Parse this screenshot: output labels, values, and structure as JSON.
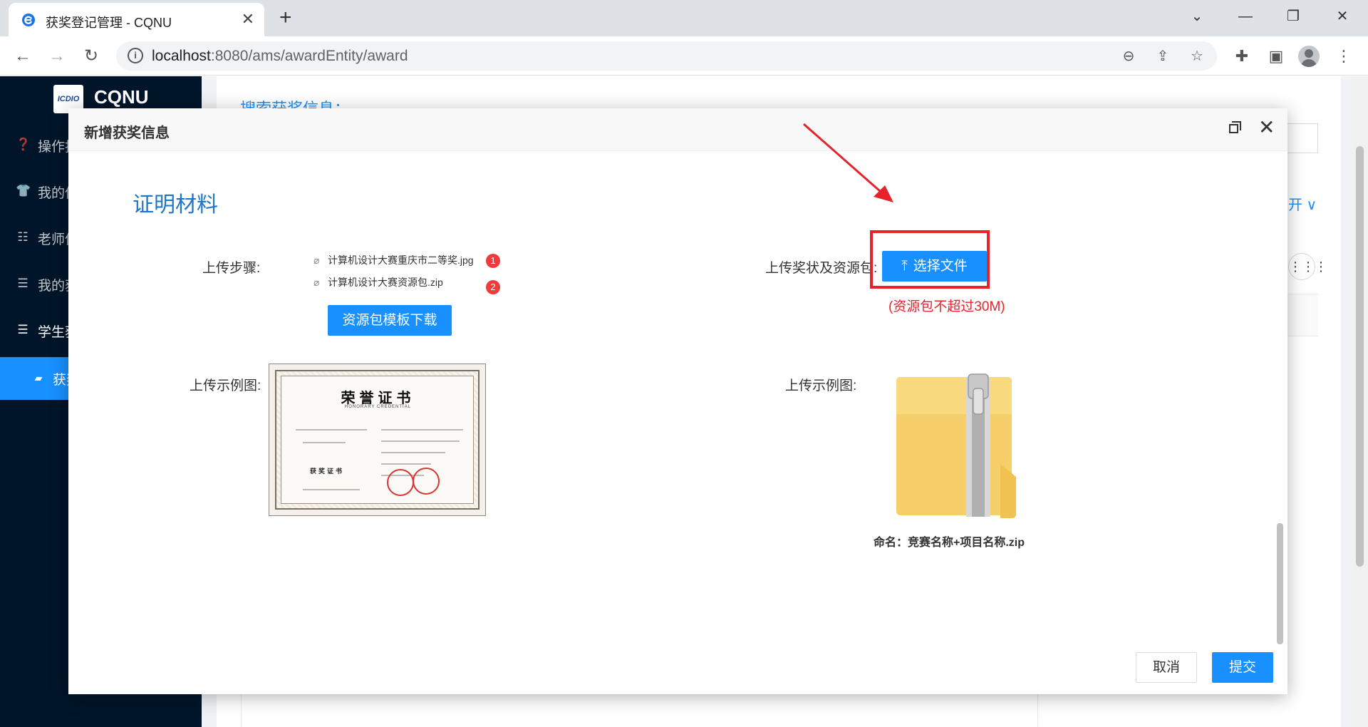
{
  "browser": {
    "tab_title": "获奖登记管理 - CQNU",
    "url_host": "localhost",
    "url_path": ":8080/ams/awardEntity/award"
  },
  "sidebar": {
    "logo_badge": "ICDIO",
    "logo_text": "CQNU",
    "items": [
      {
        "label": "操作指南",
        "icon": "question-circle-icon"
      },
      {
        "label": "我的信息",
        "icon": "shirt-icon"
      },
      {
        "label": "老师信息",
        "icon": "list-icon"
      },
      {
        "label": "我的获奖",
        "icon": "menu-icon"
      },
      {
        "label": "学生获奖",
        "icon": "menu-icon"
      },
      {
        "label": "获奖登记",
        "icon": "folder-icon"
      }
    ]
  },
  "background": {
    "search_title": "搜索获奖信息：",
    "expand_label": "开"
  },
  "modal": {
    "title": "新增获奖信息",
    "section_title": "证明材料",
    "upload_steps_label": "上传步骤:",
    "steps": [
      {
        "file": "计算机设计大赛重庆市二等奖.jpg",
        "badge": "1"
      },
      {
        "file": "计算机设计大赛资源包.zip",
        "badge": "2"
      }
    ],
    "template_button": "资源包模板下载",
    "upload_award_label": "上传奖状及资源包:",
    "choose_file_button": "选择文件",
    "size_note": "(资源包不超过30M)",
    "example_label_left": "上传示例图:",
    "example_label_right": "上传示例图:",
    "certificate": {
      "title": "荣誉证书",
      "subtitle": "HONORARY CREDENTIAL",
      "award_text": "获奖证书"
    },
    "zip_naming": "命名：竞赛名称+项目名称.zip",
    "cancel_button": "取消",
    "submit_button": "提交"
  },
  "colors": {
    "primary": "#1890ff",
    "sidebar_bg": "#001529",
    "highlight_red": "#e8222a"
  }
}
